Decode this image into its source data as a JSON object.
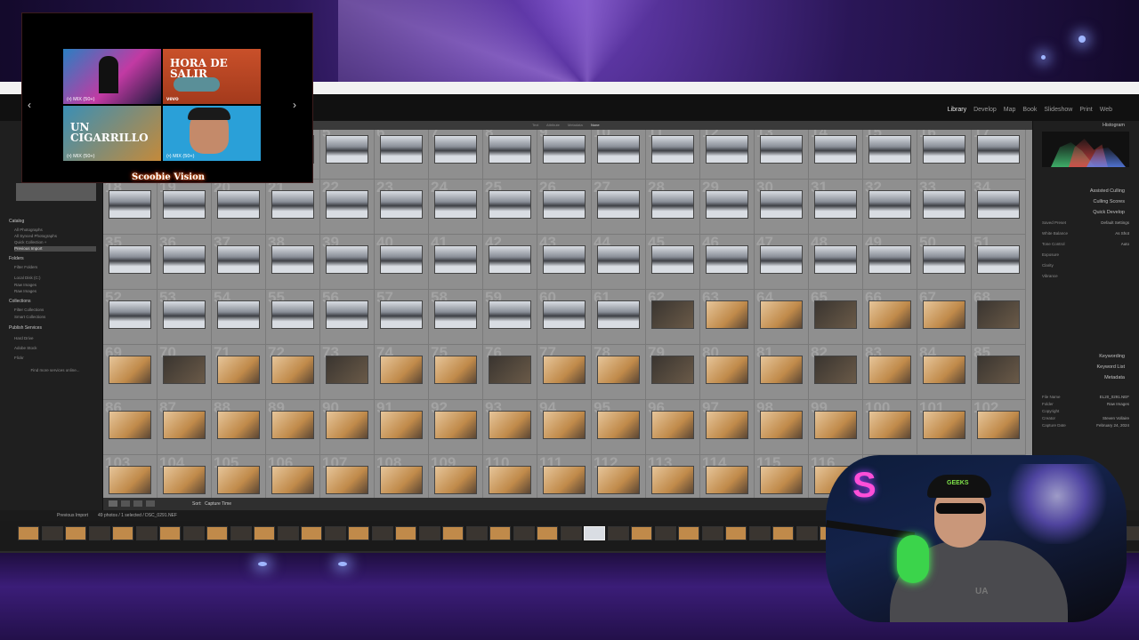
{
  "lightroom": {
    "modules": [
      "Library",
      "Develop",
      "Map",
      "Book",
      "Slideshow",
      "Print",
      "Web"
    ],
    "active_module": "Library",
    "left_panel": {
      "catalog_heading": "Catalog",
      "catalog_items": [
        "All Photographs",
        "All Synced Photographs",
        "Quick Collection +",
        "Previous Import"
      ],
      "folders_heading": "Folders",
      "folder_items": [
        "Filter Folders",
        "Local Disk (C:)",
        "Raw Images",
        "Raw Images"
      ],
      "collections_heading": "Collections",
      "collection_items": [
        "Filter Collections",
        "Smart Collections"
      ],
      "publish_heading": "Publish Services",
      "publish_items": [
        "Hard Drive",
        "Adobe Stock",
        "Flickr"
      ],
      "publish_link": "Find more services online...",
      "import_label": "Import...",
      "export_label": "Export..."
    },
    "filter_bar": [
      "Text",
      "Attribute",
      "Metadata",
      "None"
    ],
    "toolbar": {
      "sort_label": "Sort:",
      "sort_value": "Capture Time"
    },
    "right_panel": {
      "histogram_label": "Histogram",
      "sections": [
        "Assisted Culling",
        "Culling Scores",
        "Quick Develop",
        "Keywording",
        "Keyword List",
        "Metadata"
      ],
      "quick_develop_rows": [
        {
          "label": "Saved Preset",
          "value": "Default Settings"
        },
        {
          "label": "White Balance",
          "value": "As Shot"
        },
        {
          "label": "Tone Control",
          "value": "Auto"
        },
        {
          "label": "Exposure",
          "value": ""
        },
        {
          "label": "Clarity",
          "value": ""
        },
        {
          "label": "Vibrance",
          "value": ""
        }
      ],
      "metadata_rows": [
        {
          "label": "File Name",
          "value": "EL20_0291.NEF"
        },
        {
          "label": "Folder",
          "value": "Raw Images"
        },
        {
          "label": "Copyright",
          "value": ""
        },
        {
          "label": "Creator",
          "value": "Steven Vollaire"
        },
        {
          "label": "Capture Date",
          "value": "February 24, 2024"
        }
      ]
    },
    "filmstrip": {
      "source_label": "Previous Import",
      "count_label": "49 photos / 1 selected / DSC_0291.NEF"
    },
    "grid_numbers_start": 1,
    "grid_rows": 7,
    "grid_cols": 17
  },
  "music": {
    "cards": [
      {
        "title": "",
        "caption": "(•) MIX (50+)"
      },
      {
        "title": "HORA DE SALIR",
        "caption": "vevo"
      },
      {
        "title": "UN CIGARRILLO",
        "caption": "(•) MIX (50+)"
      },
      {
        "title": "",
        "caption": "(•) MIX (50+)"
      }
    ],
    "prev_symbol": "‹",
    "next_symbol": "›",
    "brand": "Scoobie Vision"
  },
  "webcam": {
    "cap_text": "GEEKS",
    "shirt_text": "UA"
  },
  "colors": {
    "grid_bg": "#8f8f8f",
    "snow": "#d9dde3",
    "interior_warm": "#c08a4a",
    "interior_dark": "#3a3530",
    "accent_purple": "#6a3fb8"
  }
}
